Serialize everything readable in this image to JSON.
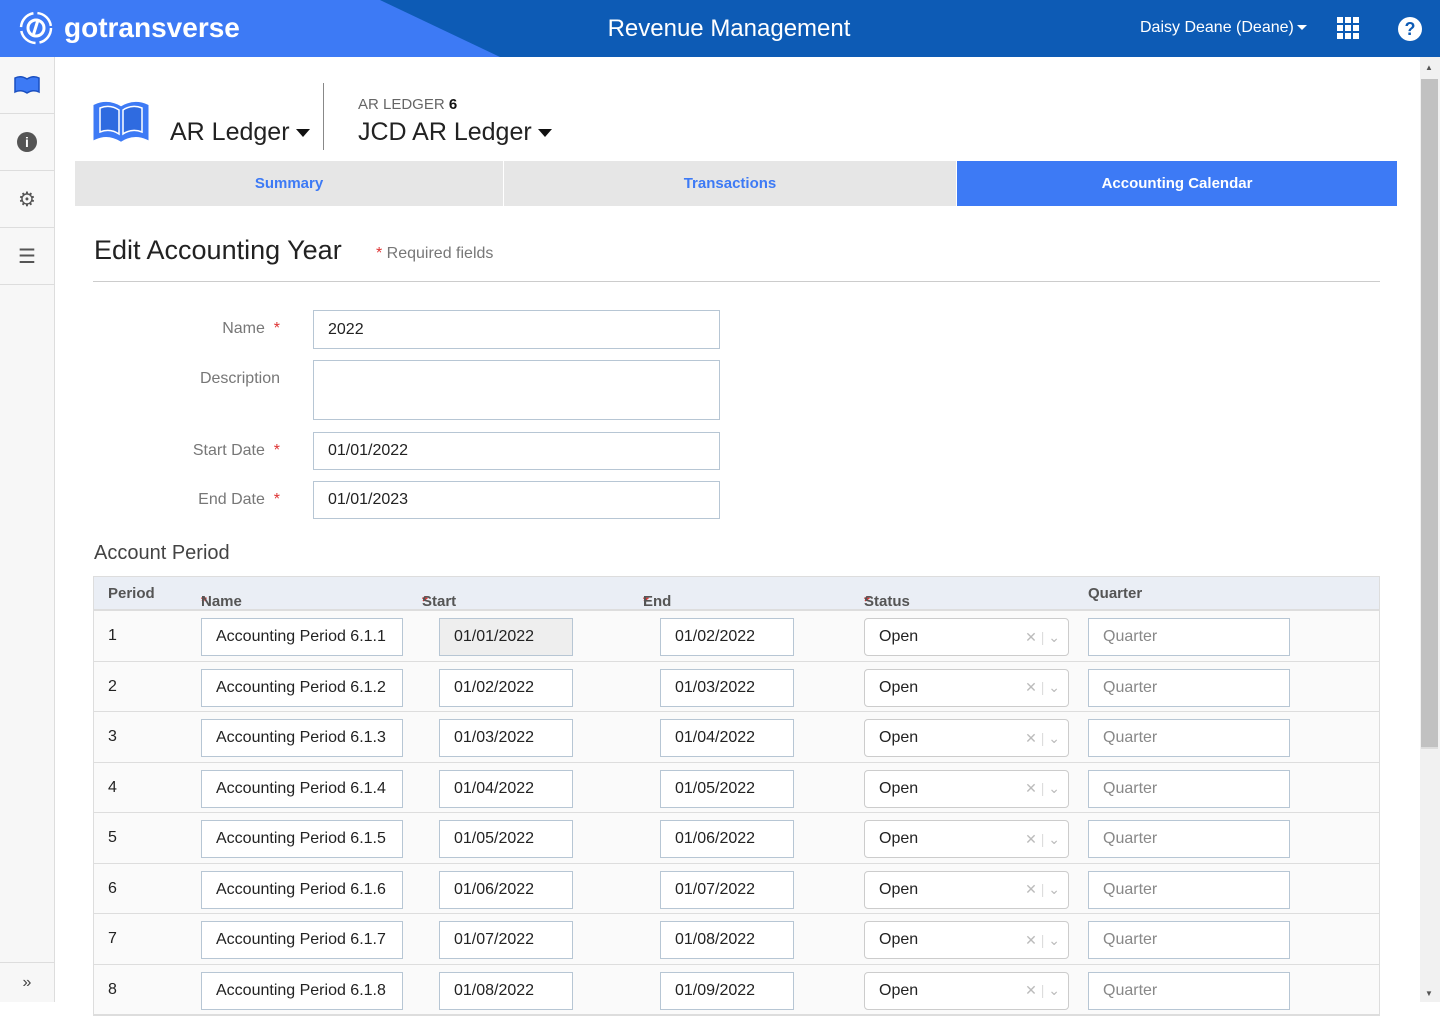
{
  "header": {
    "logo": "gotransverse",
    "title": "Revenue Management",
    "user": "Daisy Deane (Deane)"
  },
  "sidebar": {
    "items": [
      "ledger-icon",
      "info-icon",
      "settings-icon",
      "list-icon"
    ],
    "expand": "»"
  },
  "breadcrumb": {
    "section": "AR Ledger",
    "sub_label": "AR LEDGER",
    "sub_num": "6",
    "record": "JCD AR Ledger"
  },
  "tabs": [
    "Summary",
    "Transactions",
    "Accounting Calendar"
  ],
  "form": {
    "title": "Edit Accounting Year",
    "required_note": "Required fields",
    "name_label": "Name",
    "name": "2022",
    "desc_label": "Description",
    "desc": "",
    "start_label": "Start Date",
    "start": "01/01/2022",
    "end_label": "End Date",
    "end": "01/01/2023"
  },
  "period": {
    "title": "Account Period",
    "columns": [
      "Period",
      "Name",
      "Start Date",
      "End Date",
      "Status",
      "Quarter"
    ],
    "rows": [
      {
        "p": "1",
        "name": "Accounting Period 6.1.1",
        "start": "01/01/2022",
        "end": "01/02/2022",
        "status": "Open",
        "quarter": "Quarter"
      },
      {
        "p": "2",
        "name": "Accounting Period 6.1.2",
        "start": "01/02/2022",
        "end": "01/03/2022",
        "status": "Open",
        "quarter": "Quarter"
      },
      {
        "p": "3",
        "name": "Accounting Period 6.1.3",
        "start": "01/03/2022",
        "end": "01/04/2022",
        "status": "Open",
        "quarter": "Quarter"
      },
      {
        "p": "4",
        "name": "Accounting Period 6.1.4",
        "start": "01/04/2022",
        "end": "01/05/2022",
        "status": "Open",
        "quarter": "Quarter"
      },
      {
        "p": "5",
        "name": "Accounting Period 6.1.5",
        "start": "01/05/2022",
        "end": "01/06/2022",
        "status": "Open",
        "quarter": "Quarter"
      },
      {
        "p": "6",
        "name": "Accounting Period 6.1.6",
        "start": "01/06/2022",
        "end": "01/07/2022",
        "status": "Open",
        "quarter": "Quarter"
      },
      {
        "p": "7",
        "name": "Accounting Period 6.1.7",
        "start": "01/07/2022",
        "end": "01/08/2022",
        "status": "Open",
        "quarter": "Quarter"
      },
      {
        "p": "8",
        "name": "Accounting Period 6.1.8",
        "start": "01/08/2022",
        "end": "01/09/2022",
        "status": "Open",
        "quarter": "Quarter"
      }
    ]
  },
  "colors": {
    "brand": "#3d7af5",
    "header_dark": "#0d5bb5"
  }
}
